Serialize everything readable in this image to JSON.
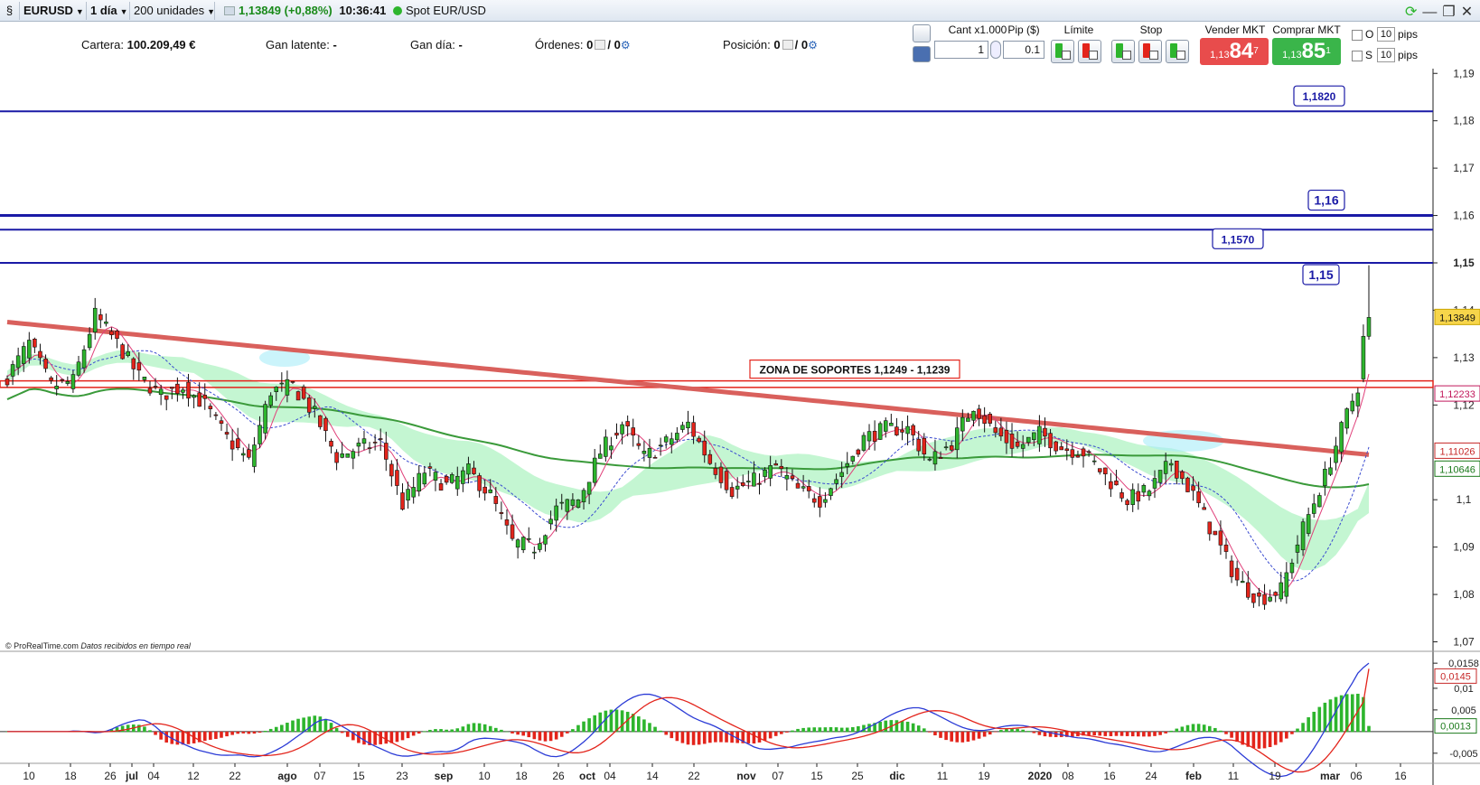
{
  "toolbar": {
    "symbol": "EURUSD",
    "timeframe": "1 día",
    "units": "200 unidades",
    "change": "1,13849 (+0,88%)",
    "time": "10:36:41",
    "instrument": "Spot EUR/USD"
  },
  "account": {
    "cartera_label": "Cartera:",
    "cartera_value": "100.209,49 €",
    "gan_latente_label": "Gan latente:",
    "gan_latente_value": "-",
    "gan_dia_label": "Gan día:",
    "gan_dia_value": "-",
    "ordenes_label": "Órdenes:",
    "ordenes_a": "0",
    "ordenes_b": "/ 0",
    "posicion_label": "Posición:",
    "posicion_a": "0",
    "posicion_b": "/ 0"
  },
  "order": {
    "cant_label": "Cant x1.000",
    "cant_value": "1",
    "pip_label": "Pip ($)",
    "pip_value": "0.1",
    "limite_label": "Límite",
    "stop_label": "Stop",
    "sell_label": "Vender MKT",
    "sell_small": "1,13",
    "sell_big": "84",
    "sell_sup": "7",
    "buy_label": "Comprar MKT",
    "buy_small": "1,13",
    "buy_big": "85",
    "buy_sup": "1",
    "o_label": "O",
    "s_label": "S",
    "o_pips": "10",
    "s_pips": "10",
    "pips_word": "pips"
  },
  "colors": {
    "up": "#2db52d",
    "down": "#e3241b",
    "hline": "#1a1aa6",
    "zone": "#e3241b",
    "ma_long": "#d9605c",
    "ma_mid": "#3a9a3a",
    "tenkan": "#e0407a",
    "kijun": "#3a4bd0",
    "cloud": "#7dec9c",
    "cloud_alt": "#a8ecf8",
    "macd": "#2b3bd6",
    "signal": "#e3241b",
    "price_tag": "#f7d54a"
  },
  "chart_data": [
    {
      "type": "candlestick",
      "title": "EURUSD",
      "ylim": [
        1.068,
        1.191
      ],
      "yticks": [
        "1,19",
        "1,18",
        "1,17",
        "1,16",
        "1,15",
        "1,14",
        "1,13",
        "1,12",
        "1,1",
        "1,09",
        "1,08",
        "1,07"
      ],
      "xticks": [
        "10",
        "18",
        "26",
        "jul",
        "04",
        "12",
        "22",
        "ago",
        "07",
        "15",
        "23",
        "sep",
        "10",
        "18",
        "26",
        "oct",
        "04",
        "14",
        "22",
        "nov",
        "07",
        "15",
        "25",
        "dic",
        "11",
        "19",
        "2020",
        "08",
        "16",
        "24",
        "feb",
        "11",
        "19",
        "mar",
        "06",
        "16"
      ],
      "hlines": [
        {
          "value": 1.182,
          "label": "1,1820"
        },
        {
          "value": 1.16,
          "label": "1,16"
        },
        {
          "value": 1.157,
          "label": "1,1570"
        },
        {
          "value": 1.15,
          "label": "1,15"
        }
      ],
      "support_zone": {
        "label": "ZONA DE SOPORTES 1,1249 - 1,1239",
        "from": 1.1239,
        "to": 1.1249
      },
      "price_tags": [
        {
          "value": 1.13849,
          "label": "1,13849"
        },
        {
          "value": 1.12233,
          "label": "1,12233"
        },
        {
          "value": 1.11026,
          "label": "1,11026"
        },
        {
          "value": 1.10646,
          "label": "1,10646"
        }
      ],
      "anchors": [
        [
          0,
          1.126
        ],
        [
          4,
          1.133
        ],
        [
          8,
          1.124
        ],
        [
          12,
          1.125
        ],
        [
          16,
          1.139
        ],
        [
          20,
          1.133
        ],
        [
          24,
          1.126
        ],
        [
          28,
          1.122
        ],
        [
          32,
          1.124
        ],
        [
          36,
          1.12
        ],
        [
          40,
          1.113
        ],
        [
          44,
          1.108
        ],
        [
          48,
          1.123
        ],
        [
          52,
          1.124
        ],
        [
          56,
          1.118
        ],
        [
          60,
          1.109
        ],
        [
          64,
          1.111
        ],
        [
          68,
          1.112
        ],
        [
          72,
          1.099
        ],
        [
          76,
          1.106
        ],
        [
          80,
          1.103
        ],
        [
          84,
          1.106
        ],
        [
          88,
          1.101
        ],
        [
          92,
          1.091
        ],
        [
          96,
          1.09
        ],
        [
          100,
          1.098
        ],
        [
          104,
          1.1
        ],
        [
          108,
          1.11
        ],
        [
          112,
          1.116
        ],
        [
          116,
          1.109
        ],
        [
          120,
          1.112
        ],
        [
          124,
          1.116
        ],
        [
          128,
          1.108
        ],
        [
          132,
          1.102
        ],
        [
          136,
          1.104
        ],
        [
          140,
          1.107
        ],
        [
          144,
          1.102
        ],
        [
          148,
          1.1
        ],
        [
          152,
          1.106
        ],
        [
          156,
          1.113
        ],
        [
          160,
          1.115
        ],
        [
          164,
          1.115
        ],
        [
          168,
          1.108
        ],
        [
          172,
          1.112
        ],
        [
          176,
          1.12
        ],
        [
          180,
          1.114
        ],
        [
          184,
          1.111
        ],
        [
          188,
          1.114
        ],
        [
          192,
          1.111
        ],
        [
          196,
          1.11
        ],
        [
          200,
          1.105
        ],
        [
          204,
          1.1
        ],
        [
          208,
          1.102
        ],
        [
          212,
          1.108
        ],
        [
          216,
          1.101
        ],
        [
          220,
          1.092
        ],
        [
          224,
          1.083
        ],
        [
          228,
          1.079
        ],
        [
          232,
          1.081
        ],
        [
          236,
          1.094
        ],
        [
          240,
          1.105
        ],
        [
          244,
          1.118
        ],
        [
          246,
          1.124
        ],
        [
          248,
          1.1385
        ]
      ],
      "candle_count": 249,
      "indicators": [
        "SMA largo",
        "SMA medio",
        "Tenkan",
        "Kijun",
        "Ichimoku"
      ]
    },
    {
      "type": "line",
      "title": "MACD",
      "ylim": [
        -0.0065,
        0.0175
      ],
      "yticks": [
        "0,0158",
        "0,01",
        "0,005",
        "-0,005"
      ],
      "price_tags": [
        {
          "value": 0.0145,
          "label": "0,0145"
        },
        {
          "value": 0.0013,
          "label": "0,0013"
        }
      ]
    }
  ],
  "footer": {
    "credit": "© ProRealTime.com",
    "credit2": "Datos recibidos en tiempo real"
  }
}
